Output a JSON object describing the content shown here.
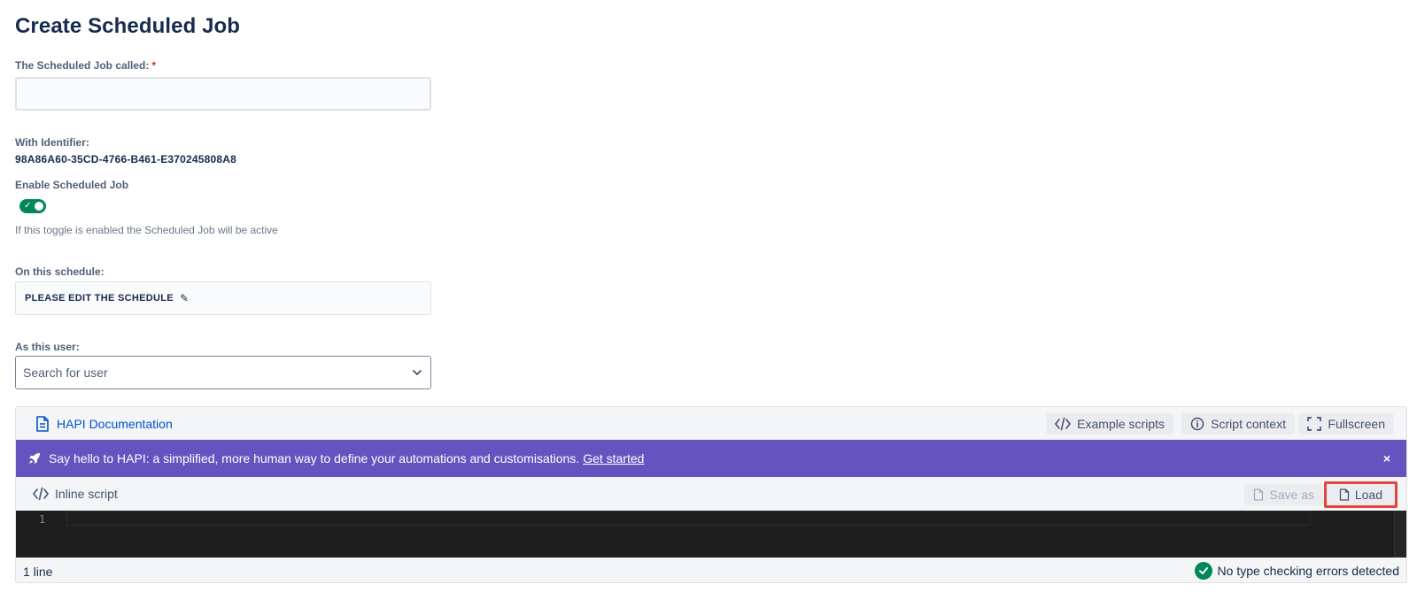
{
  "page": {
    "title": "Create Scheduled Job"
  },
  "form": {
    "name_label": "The Scheduled Job called:",
    "required_mark": "*",
    "name_value": "",
    "identifier_label": "With Identifier:",
    "identifier_value": "98A86A60-35CD-4766-B461-E370245808A8",
    "enable_label": "Enable Scheduled Job",
    "enable_state": true,
    "enable_help": "If this toggle is enabled the Scheduled Job will be active",
    "schedule_label": "On this schedule:",
    "schedule_value": "PLEASE EDIT THE SCHEDULE",
    "user_label": "As this user:",
    "user_placeholder": "Search for user"
  },
  "editor": {
    "hapi_doc_label": "HAPI Documentation",
    "example_scripts_label": "Example scripts",
    "script_context_label": "Script context",
    "fullscreen_label": "Fullscreen",
    "banner": {
      "text": "Say hello to HAPI: a simplified, more human way to define your automations and customisations.",
      "link": "Get started",
      "close": "×",
      "color": "#6554c0"
    },
    "inline_script_label": "Inline script",
    "save_as_label": "Save as",
    "load_label": "Load",
    "line_number": "1",
    "line_count": "1 line",
    "status_text": "No type checking errors detected",
    "status_color": "#00875a",
    "highlight_color": "#e5453d"
  },
  "icons": {
    "pencil": "✎",
    "check": "✓"
  }
}
